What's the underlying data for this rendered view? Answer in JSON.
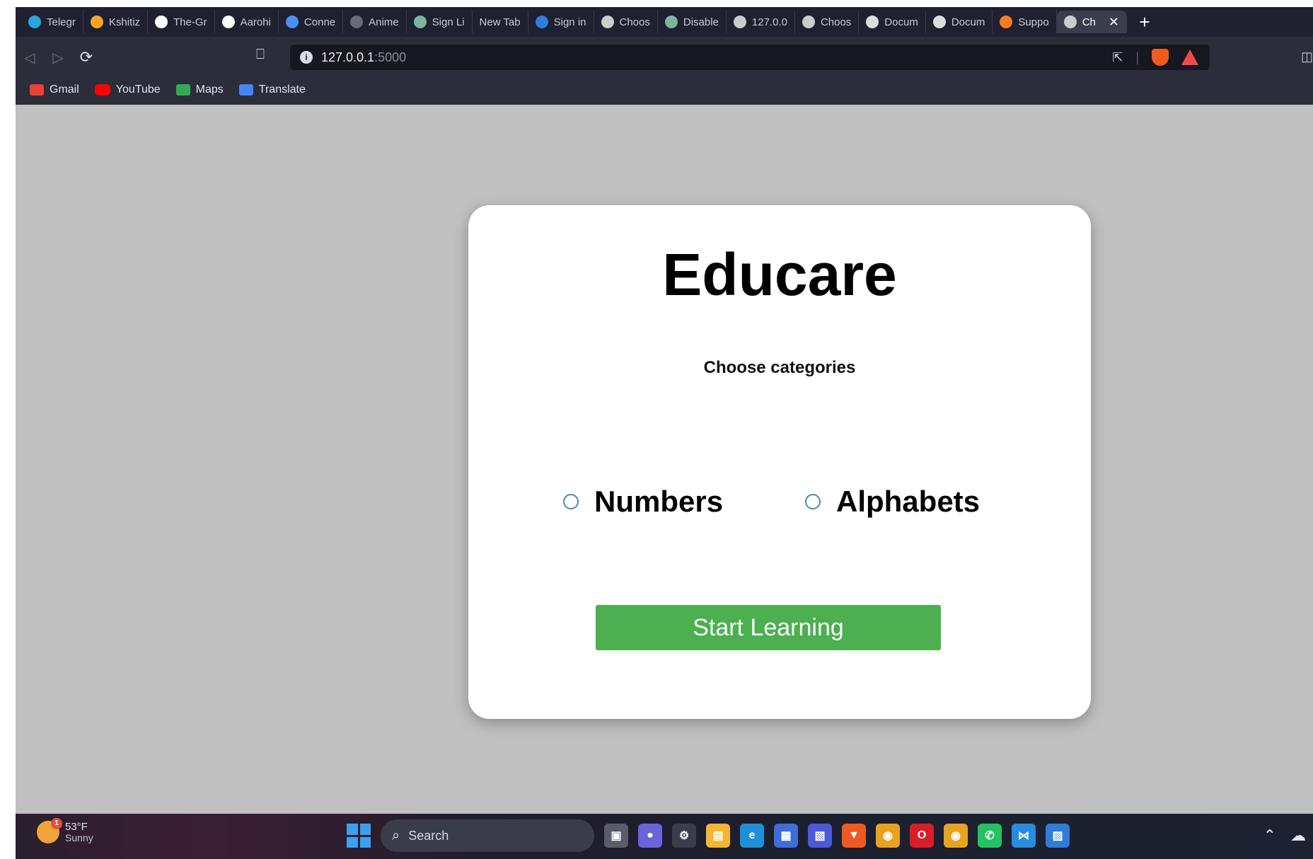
{
  "browser": {
    "tabs": [
      {
        "label": "Telegr",
        "icon": "telegram-icon",
        "color": "#2aa3df"
      },
      {
        "label": "Kshitiz",
        "icon": "infinity-icon",
        "color": "#f5a623"
      },
      {
        "label": "The-Gr",
        "icon": "github-icon",
        "color": "#ffffff"
      },
      {
        "label": "Aarohi",
        "icon": "github-icon",
        "color": "#ffffff"
      },
      {
        "label": "Conne",
        "icon": "wave-icon",
        "color": "#4c8cf5"
      },
      {
        "label": "Anime",
        "icon": "play-icon",
        "color": "#6a6a7a"
      },
      {
        "label": "Sign Li",
        "icon": "page-icon",
        "color": "#7fb3a0"
      },
      {
        "label": "New Tab",
        "icon": "",
        "color": ""
      },
      {
        "label": "Sign in",
        "icon": "s-icon",
        "color": "#2f7ee0"
      },
      {
        "label": "Choos",
        "icon": "globe-icon",
        "color": "#cccccc"
      },
      {
        "label": "Disable",
        "icon": "page-icon",
        "color": "#7fb3a0"
      },
      {
        "label": "127.0.0",
        "icon": "globe-icon",
        "color": "#cccccc"
      },
      {
        "label": "Choos",
        "icon": "globe-icon",
        "color": "#cccccc"
      },
      {
        "label": "Docum",
        "icon": "l-icon",
        "color": "#dddddd"
      },
      {
        "label": "Docum",
        "icon": "l-icon",
        "color": "#dddddd"
      },
      {
        "label": "Suppo",
        "icon": "support-icon",
        "color": "#f57c22"
      },
      {
        "label": "Ch",
        "icon": "globe-icon",
        "color": "#cccccc"
      }
    ],
    "close_glyph": "✕",
    "new_tab_glyph": "+",
    "url_host": "127.0.0.1",
    "url_port": ":5000",
    "bookmarks": [
      {
        "label": "Gmail",
        "icon": "gmail-icon"
      },
      {
        "label": "YouTube",
        "icon": "youtube-icon"
      },
      {
        "label": "Maps",
        "icon": "maps-icon"
      },
      {
        "label": "Translate",
        "icon": "translate-icon"
      }
    ]
  },
  "page": {
    "title": "Educare",
    "subtitle": "Choose categories",
    "options": [
      {
        "label": "Numbers",
        "selected": false
      },
      {
        "label": "Alphabets",
        "selected": false
      }
    ],
    "start_button": "Start Learning",
    "colors": {
      "background": "#c0c0c0",
      "card": "#ffffff",
      "button": "#4caf50",
      "radio_border": "#4b87b8"
    }
  },
  "taskbar": {
    "weather_temp": "53°F",
    "weather_condition": "Sunny",
    "weather_badge": "1",
    "search_label": "Search"
  }
}
